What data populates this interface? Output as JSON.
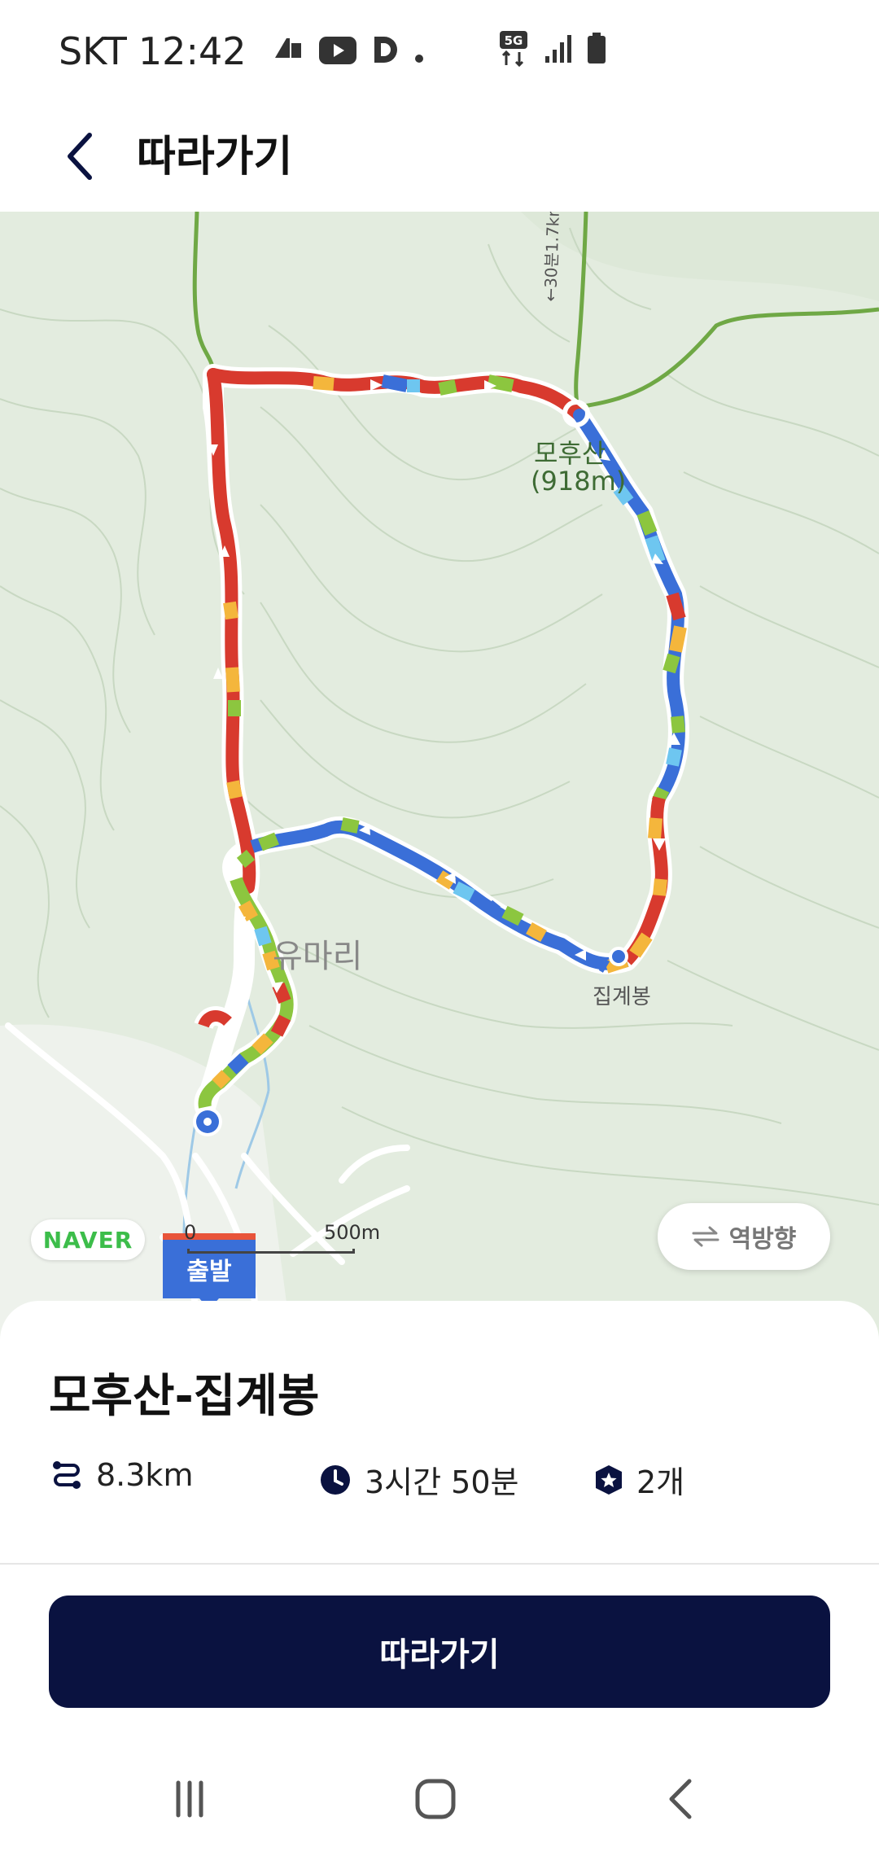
{
  "status_bar": {
    "carrier": "SKT",
    "time": "12:42",
    "network": "5G"
  },
  "header": {
    "title": "따라가기"
  },
  "map": {
    "provider_logo": "NAVER",
    "scale_start": "0",
    "scale_end": "500m",
    "reverse_label": "역방향",
    "start_label": "출발",
    "peak_name": "모후산",
    "peak_elevation": "(918m)",
    "summit_name": "집계봉",
    "village_name": "유마리",
    "trail_label": "←30분1.7km"
  },
  "course": {
    "title": "모후산-집계봉",
    "distance": "8.3km",
    "duration": "3시간 50분",
    "checkpoints": "2개"
  },
  "actions": {
    "follow_label": "따라가기"
  },
  "colors": {
    "primary": "#0a1240",
    "route_red": "#d83a2e",
    "route_blue": "#3a6fd8",
    "route_green": "#8cc63f",
    "route_yellow": "#f4b63c"
  }
}
